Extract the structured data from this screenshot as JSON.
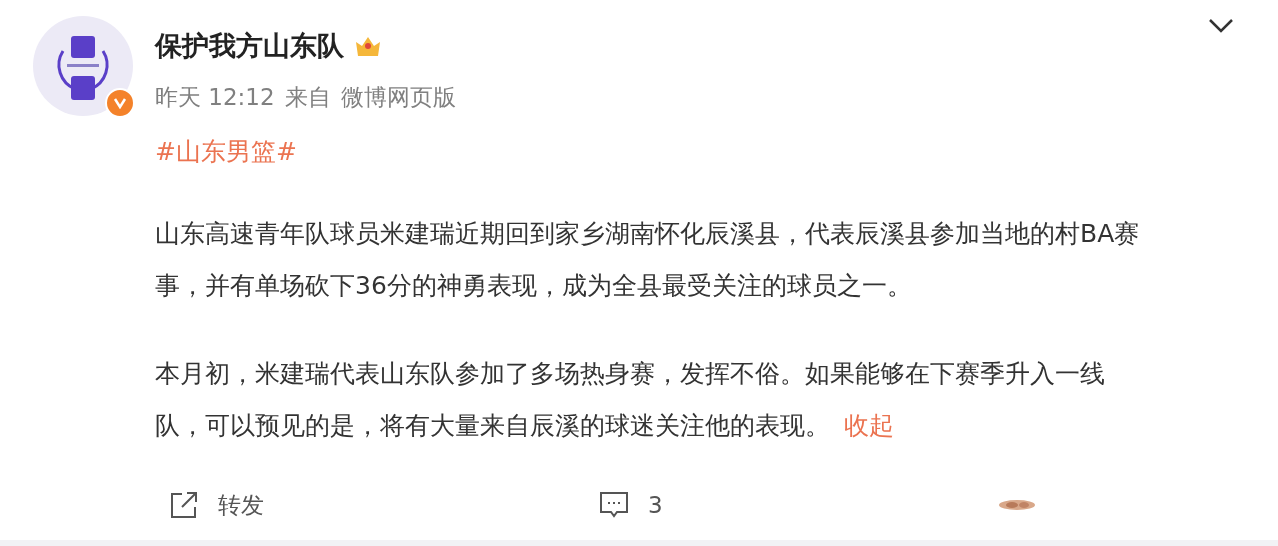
{
  "post": {
    "author": "保护我方山东队",
    "verified": true,
    "time": "昨天 12:12",
    "source_prefix": "来自",
    "source": "微博网页版",
    "hashtag": "#山东男篮#",
    "paragraphs": [
      "山东高速青年队球员米建瑞近期回到家乡湖南怀化辰溪县，代表辰溪县参加当地的村BA赛事，并有单场砍下36分的神勇表现，成为全县最受关注的球员之一。",
      "本月初，米建瑞代表山东队参加了多场热身赛，发挥不俗。如果能够在下赛季升入一线队，可以预见的是，将有大量来自辰溪的球迷关注他的表现。"
    ],
    "collapse_link": "收起"
  },
  "actions": [
    {
      "kind": "repost",
      "label": "转发"
    },
    {
      "kind": "comment",
      "label": "3"
    },
    {
      "kind": "like"
    }
  ]
}
